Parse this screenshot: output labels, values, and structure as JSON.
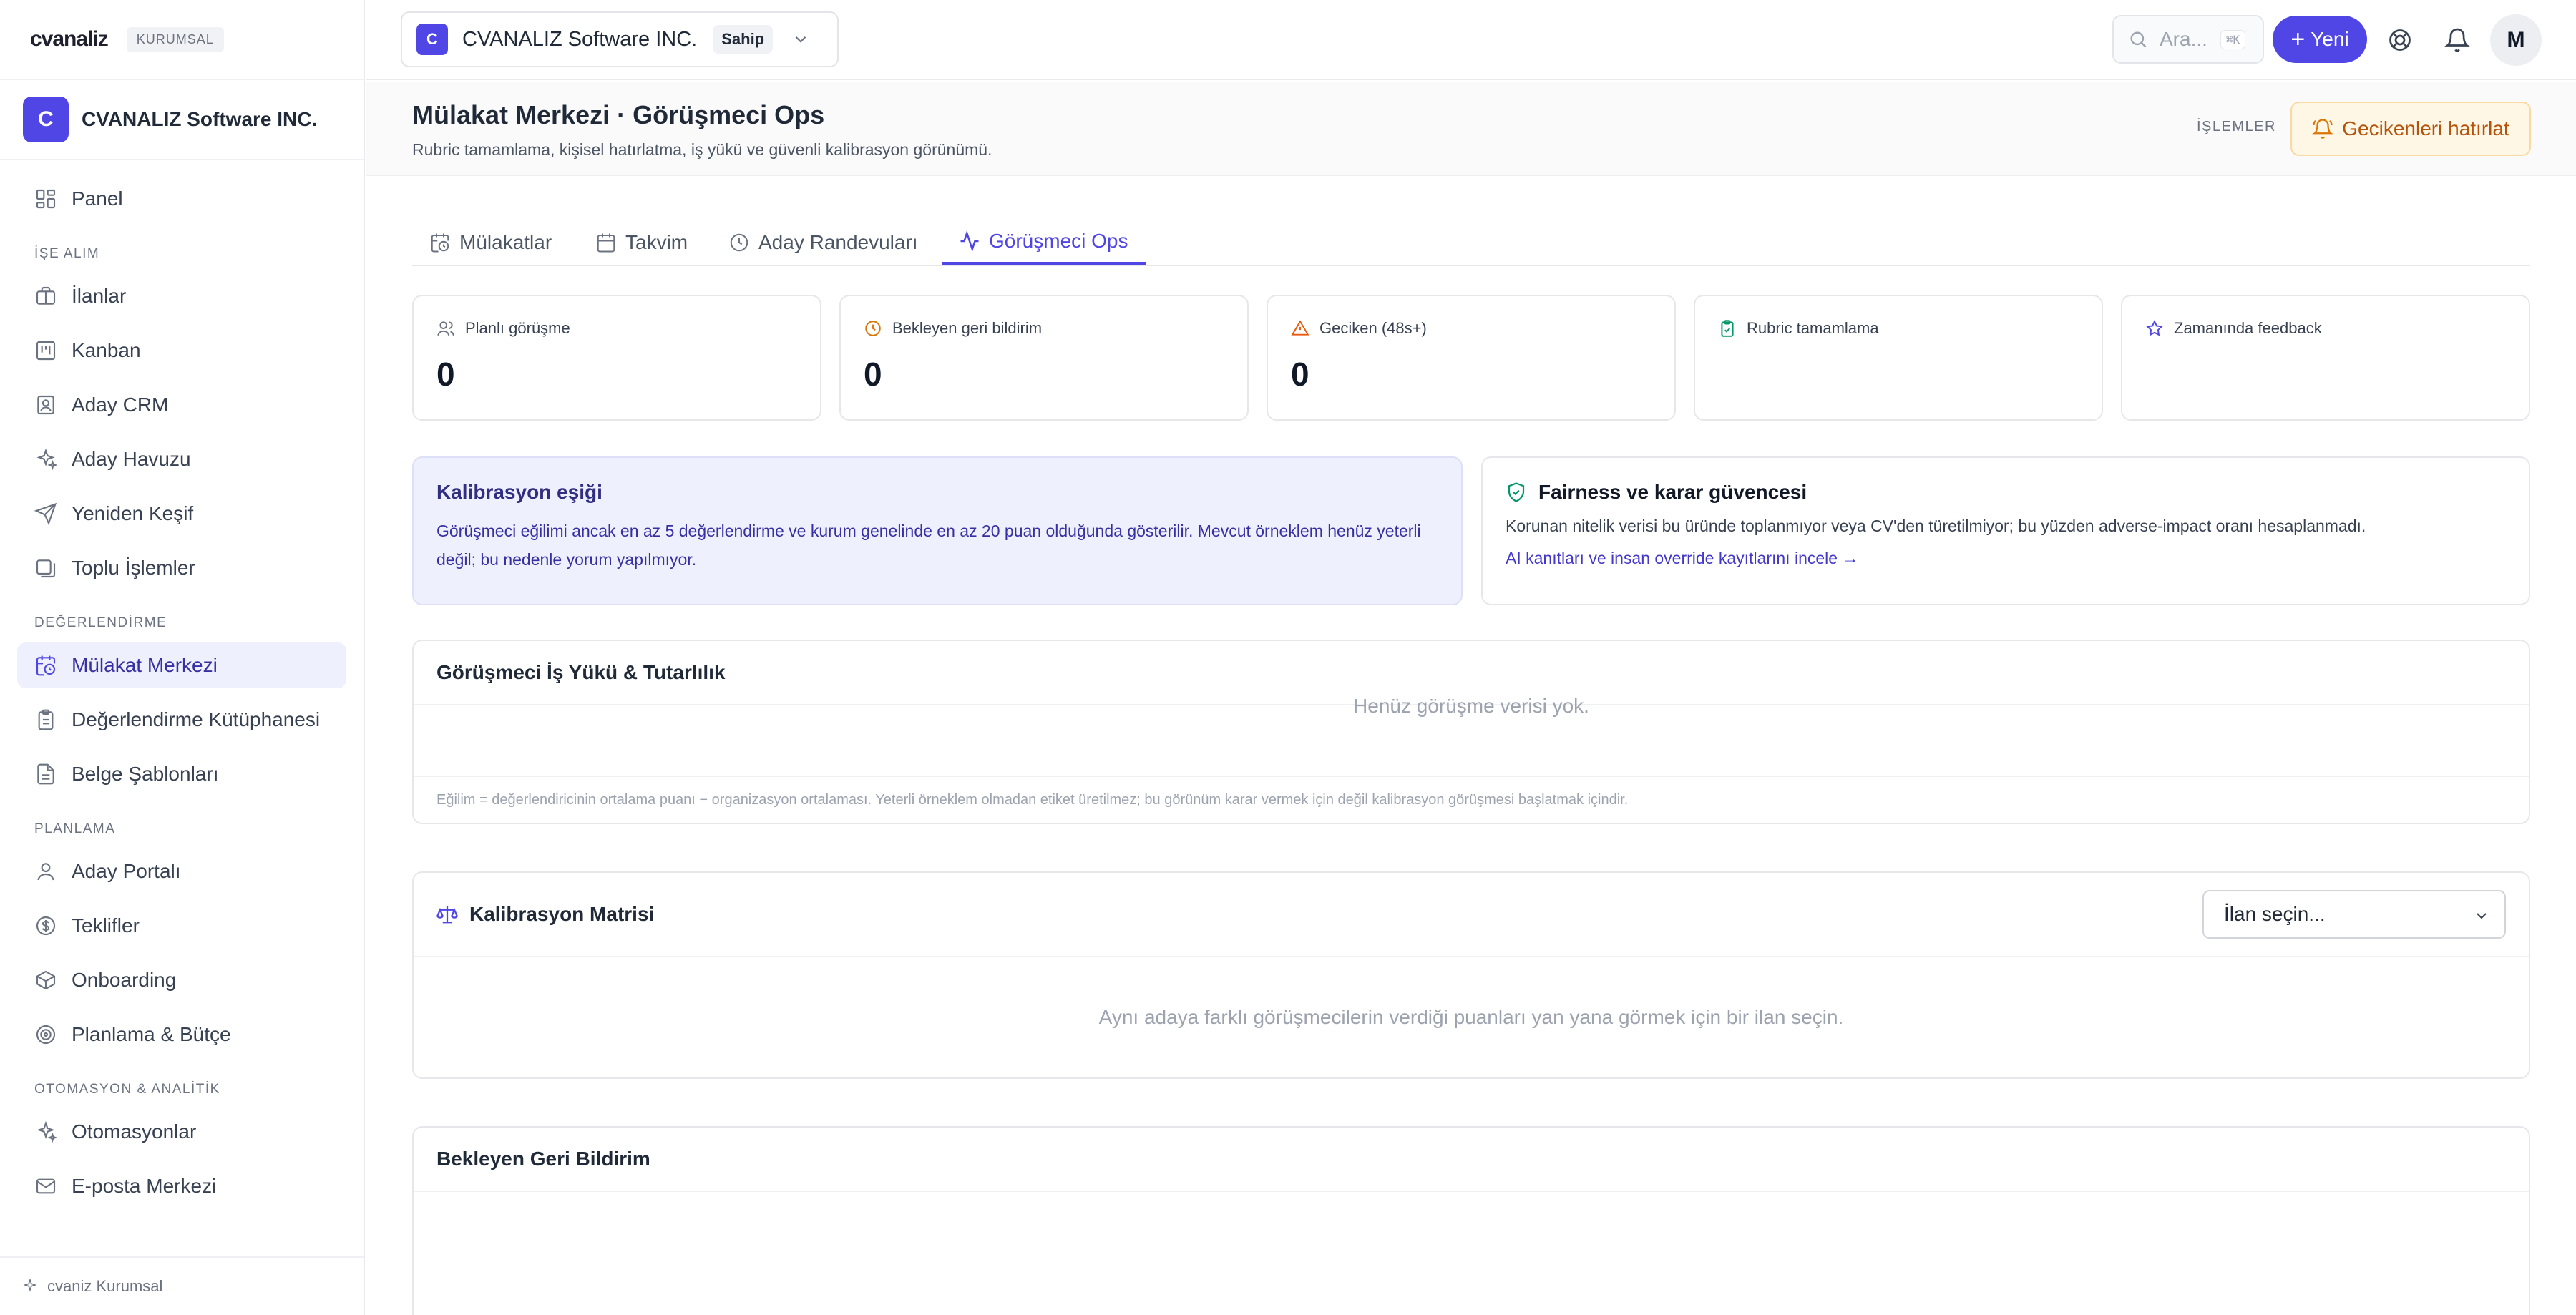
{
  "brand": {
    "logo": "cvanaliz",
    "plan_badge": "KURUMSAL"
  },
  "org": {
    "avatar": "C",
    "name": "CVANALIZ Software INC."
  },
  "sidebar": {
    "items": [
      {
        "label": "Panel",
        "icon": "dashboard-icon"
      },
      {
        "section": "İŞE ALIM"
      },
      {
        "label": "İlanlar",
        "icon": "briefcase-icon"
      },
      {
        "label": "Kanban",
        "icon": "kanban-icon"
      },
      {
        "label": "Aday CRM",
        "icon": "contact-card-icon"
      },
      {
        "label": "Aday Havuzu",
        "icon": "sparkles-icon"
      },
      {
        "label": "Yeniden Keşif",
        "icon": "send-icon"
      },
      {
        "label": "Toplu İşlemler",
        "icon": "layers-icon"
      },
      {
        "section": "DEĞERLENDİRME"
      },
      {
        "label": "Mülakat Merkezi",
        "icon": "calendar-clock-icon",
        "active": true
      },
      {
        "label": "Değerlendirme Kütüphanesi",
        "icon": "clipboard-icon"
      },
      {
        "label": "Belge Şablonları",
        "icon": "document-icon"
      },
      {
        "section": "PLANLAMA"
      },
      {
        "label": "Aday Portalı",
        "icon": "user-icon"
      },
      {
        "label": "Teklifler",
        "icon": "dollar-circle-icon"
      },
      {
        "label": "Onboarding",
        "icon": "package-icon"
      },
      {
        "label": "Planlama & Bütçe",
        "icon": "target-icon"
      },
      {
        "section": "OTOMASYON & ANALİTİK"
      },
      {
        "label": "Otomasyonlar",
        "icon": "sparkles-icon"
      },
      {
        "label": "E-posta Merkezi",
        "icon": "mail-icon"
      }
    ],
    "footer": "cvaniz Kurumsal"
  },
  "topbar": {
    "org_avatar": "C",
    "org_name": "CVANALIZ Software INC.",
    "role": "Sahip",
    "search_placeholder": "Ara...",
    "search_shortcut": "⌘K",
    "new_label": "Yeni",
    "user_initial": "M"
  },
  "header": {
    "title": "Mülakat Merkezi · Görüşmeci Ops",
    "subtitle": "Rubric tamamlama, kişisel hatırlatma, iş yükü ve güvenli kalibrasyon görünümü.",
    "actions_label": "İŞLEMLER",
    "remind_label": "Gecikenleri hatırlat"
  },
  "tabs": [
    {
      "label": "Mülakatlar",
      "icon": "calendar-clock-icon"
    },
    {
      "label": "Takvim",
      "icon": "calendar-icon"
    },
    {
      "label": "Aday Randevuları",
      "icon": "clock-icon"
    },
    {
      "label": "Görüşmeci Ops",
      "icon": "activity-icon",
      "active": true
    }
  ],
  "stats": [
    {
      "label": "Planlı görüşme",
      "value": "0",
      "icon": "users-icon",
      "color": "#6b7280"
    },
    {
      "label": "Bekleyen geri bildirim",
      "value": "0",
      "icon": "clock-icon",
      "color": "#d97706"
    },
    {
      "label": "Geciken (48s+)",
      "value": "0",
      "icon": "alert-triangle-icon",
      "color": "#ea580c"
    },
    {
      "label": "Rubric tamamlama",
      "value": "",
      "icon": "clipboard-check-icon",
      "color": "#059669"
    },
    {
      "label": "Zamanında feedback",
      "value": "",
      "icon": "star-icon",
      "color": "#4f46e5"
    }
  ],
  "calibration_notice": {
    "title": "Kalibrasyon eşiği",
    "body": "Görüşmeci eğilimi ancak en az 5 değerlendirme ve kurum genelinde en az 20 puan olduğunda gösterilir. Mevcut örneklem henüz yeterli değil; bu nedenle yorum yapılmıyor."
  },
  "fairness": {
    "title": "Fairness ve karar güvencesi",
    "body": "Korunan nitelik verisi bu üründe toplanmıyor veya CV'den türetilmiyor; bu yüzden adverse-impact oranı hesaplanmadı.",
    "link": "AI kanıtları ve insan override kayıtlarını incele →"
  },
  "workload": {
    "title": "Görüşmeci İş Yükü & Tutarlılık",
    "empty": "Henüz görüşme verisi yok.",
    "note": "Eğilim = değerlendiricinin ortalama puanı − organizasyon ortalaması. Yeterli örneklem olmadan etiket üretilmez; bu görünüm karar vermek için değil kalibrasyon görüşmesi başlatmak içindir."
  },
  "matrix": {
    "title": "Kalibrasyon Matrisi",
    "select_placeholder": "İlan seçin...",
    "empty": "Aynı adaya farklı görüşmecilerin verdiği puanları yan yana görmek için bir ilan seçin."
  },
  "pending": {
    "title": "Bekleyen Geri Bildirim"
  },
  "colors": {
    "accent": "#4f46e5",
    "warning": "#d97706",
    "success": "#059669"
  }
}
